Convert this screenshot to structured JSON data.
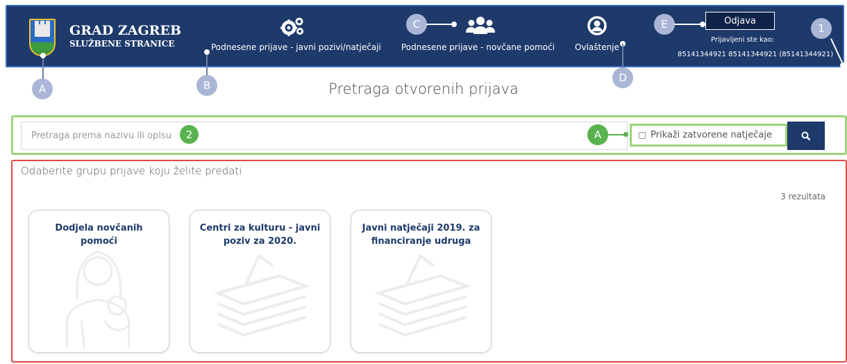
{
  "header": {
    "title": "GRAD ZAGREB",
    "subtitle": "SLUŽBENE STRANICE",
    "nav": [
      {
        "label": "Podnesene prijave - javni pozivi/natječaji",
        "icon": "gears-icon"
      },
      {
        "label": "Podnesene prijave - novčane pomoći",
        "icon": "users-icon"
      },
      {
        "label": "Ovlaštenje",
        "icon": "user-circle-icon"
      }
    ],
    "logout_label": "Odjava",
    "logged_in_label": "Prijavljeni ste kao:",
    "logged_in_user": "85141344921 85141344921 (85141344921)"
  },
  "callouts": {
    "logo": "A",
    "nav_applications": "B",
    "nav_payments": "C",
    "nav_authorization": "D",
    "logout": "E",
    "header_area": "1",
    "search_area": "2",
    "closed_filter": "A"
  },
  "main": {
    "title": "Pretraga otvorenih prijava",
    "search_placeholder": "Pretraga prema nazivu ili opisu",
    "show_closed_label": "Prikaži zatvorene natječaje",
    "show_closed_checked": false,
    "section_heading": "Odaberite grupu prijave koju želite predati",
    "results_count": "3 rezultata",
    "cards": [
      {
        "title": "Dodjela novčanih pomoći",
        "art": "mother-child-icon"
      },
      {
        "title": "Centri za kulturu - javni poziv za 2020.",
        "art": "document-stack-icon"
      },
      {
        "title": "Javni natječaji 2019. za financiranje udruga",
        "art": "document-stack-icon"
      }
    ]
  },
  "colors": {
    "header_bg": "#1e3a6b",
    "header_border": "#3b6cc4",
    "search_frame": "#9bd37a",
    "content_frame": "#e04848",
    "card_title": "#1e3a6b",
    "callout_blue": "#a9b6d6",
    "callout_green": "#58b24e"
  }
}
